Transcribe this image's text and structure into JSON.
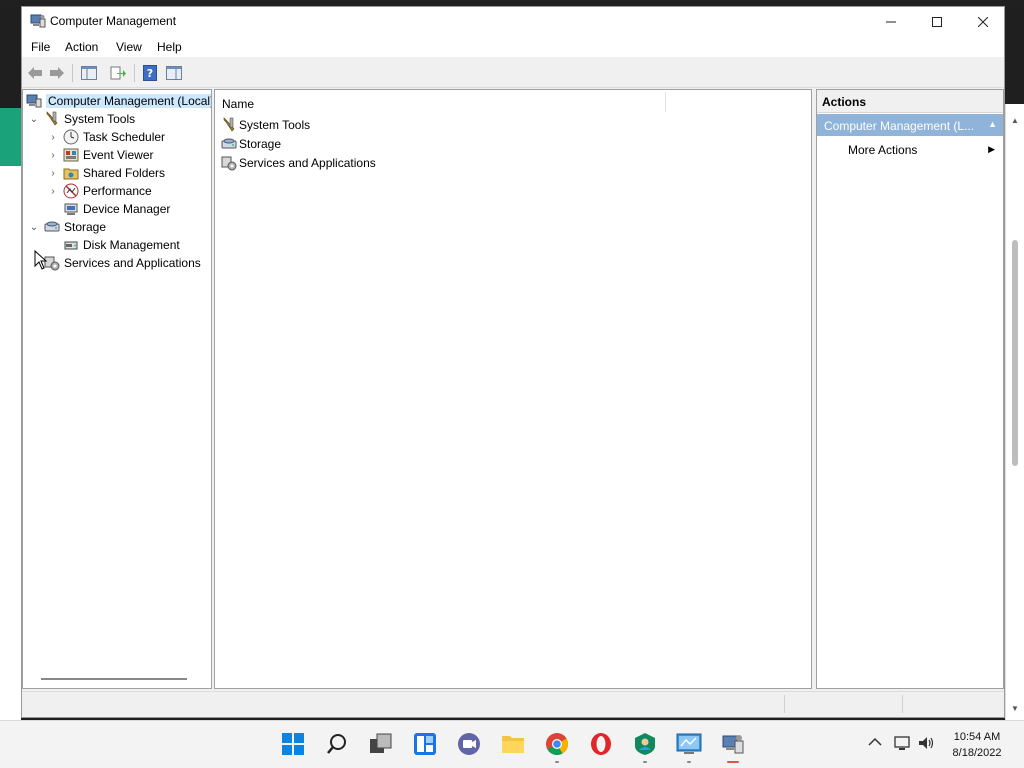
{
  "window": {
    "title": "Computer Management"
  },
  "menu": [
    "File",
    "Action",
    "View",
    "Help"
  ],
  "toolbar": {
    "buttons": [
      "back-arrow-icon",
      "forward-arrow-icon",
      "show-hide-tree-icon",
      "export-list-icon",
      "help-icon",
      "show-hide-action-pane-icon"
    ]
  },
  "tree": {
    "root": "Computer Management (Local)",
    "system_tools": "System Tools",
    "task_scheduler": "Task Scheduler",
    "event_viewer": "Event Viewer",
    "shared_folders": "Shared Folders",
    "performance": "Performance",
    "device_manager": "Device Manager",
    "storage": "Storage",
    "disk_management": "Disk Management",
    "services_apps": "Services and Applications"
  },
  "list": {
    "column_name": "Name",
    "items": [
      "System Tools",
      "Storage",
      "Services and Applications"
    ]
  },
  "actions": {
    "header": "Actions",
    "group": "Computer Management (L...",
    "item": "More Actions"
  },
  "taskbar": {
    "time": "10:54 AM",
    "date": "8/18/2022"
  },
  "colors": {
    "selection": "#cce8ff",
    "actions_group": "#8fb3d9",
    "accent": "#0078d4"
  }
}
